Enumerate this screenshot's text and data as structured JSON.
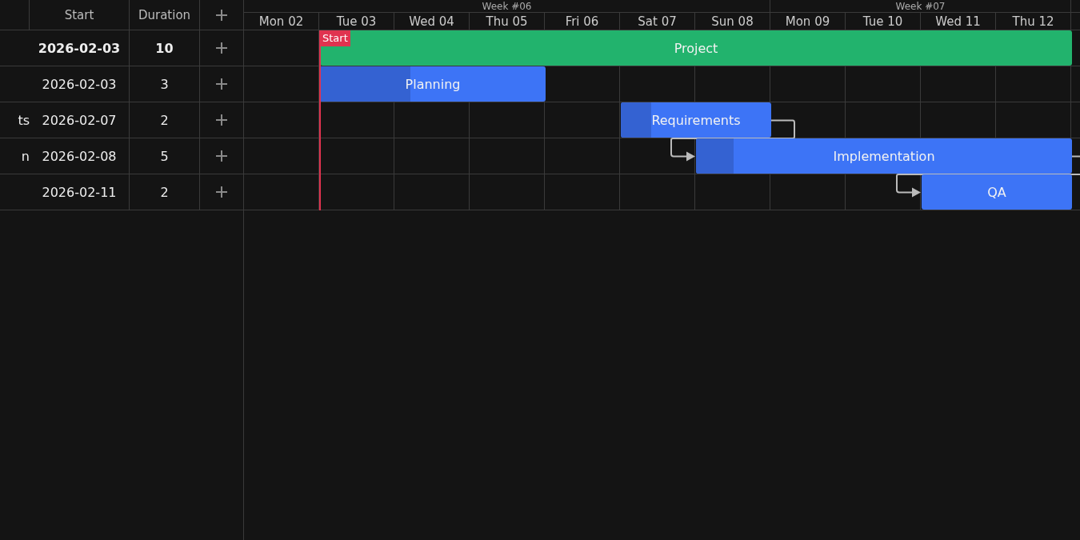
{
  "grid": {
    "columns": [
      "Start",
      "Duration"
    ]
  },
  "timeline": {
    "weeks": [
      {
        "label": "Week #06",
        "days": [
          "Mon 02",
          "Tue 03",
          "Wed 04",
          "Thu 05",
          "Fri 06",
          "Sat 07",
          "Sun 08"
        ]
      },
      {
        "label": "Week #07",
        "days": [
          "Mon 09",
          "Tue 10",
          "Wed 11",
          "Thu 12"
        ]
      }
    ],
    "marker": {
      "label": "Start"
    }
  },
  "tasks": [
    {
      "kind": "summary",
      "bar_label": "Project",
      "start": "2026-02-03",
      "duration": "10",
      "linked_from_previous": false
    },
    {
      "kind": "task",
      "bar_label": "Planning",
      "start": "2026-02-03",
      "duration": "3",
      "level": 0.4,
      "linked_from_previous": false
    },
    {
      "kind": "task",
      "name": "ts",
      "bar_label": "Requirements",
      "start": "2026-02-07",
      "duration": "2",
      "level": 0.2,
      "linked_from_previous": false
    },
    {
      "kind": "task",
      "name": "n",
      "bar_label": "Implementation",
      "start": "2026-02-08",
      "duration": "5",
      "level": 0.1,
      "linked_from_previous": true
    },
    {
      "kind": "task",
      "bar_label": "QA",
      "start": "2026-02-11",
      "duration": "2",
      "linked_from_previous": true
    }
  ]
}
